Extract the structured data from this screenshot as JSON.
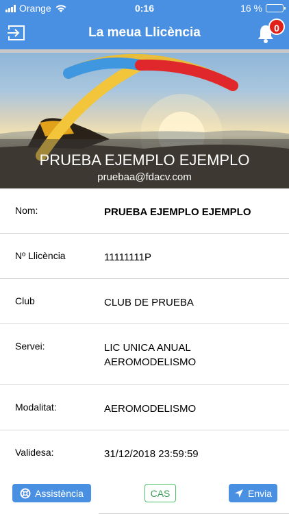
{
  "status": {
    "carrier": "Orange",
    "time": "0:16",
    "battery": "16 %",
    "battery_level": 0.16,
    "battery_color": "#e53030"
  },
  "nav": {
    "title": "La meua Llicència",
    "notification_count": "0",
    "logout_icon": "logout-icon",
    "bell_icon": "bell-icon"
  },
  "profile": {
    "name": "PRUEBA EJEMPLO EJEMPLO",
    "email": "pruebaa@fdacv.com"
  },
  "fields": [
    {
      "label": "Nom:",
      "value": "PRUEBA EJEMPLO EJEMPLO"
    },
    {
      "label": "Nº Llicència",
      "value": "11111111P"
    },
    {
      "label": "Club",
      "value": "CLUB DE PRUEBA"
    },
    {
      "label": "Servei:",
      "value": "LIC UNICA ANUAL",
      "value2": "AEROMODELISMO"
    },
    {
      "label": "Modalitat:",
      "value": "AEROMODELISMO"
    },
    {
      "label": "Validesa:",
      "value": "31/12/2018 23:59:59"
    }
  ],
  "toolbar": {
    "assist_label": "Assistència",
    "cas_label": "CAS",
    "send_label": "Envia"
  },
  "colors": {
    "accent": "#4a90e2",
    "badge": "#e0201b",
    "cas": "#4cc066"
  }
}
